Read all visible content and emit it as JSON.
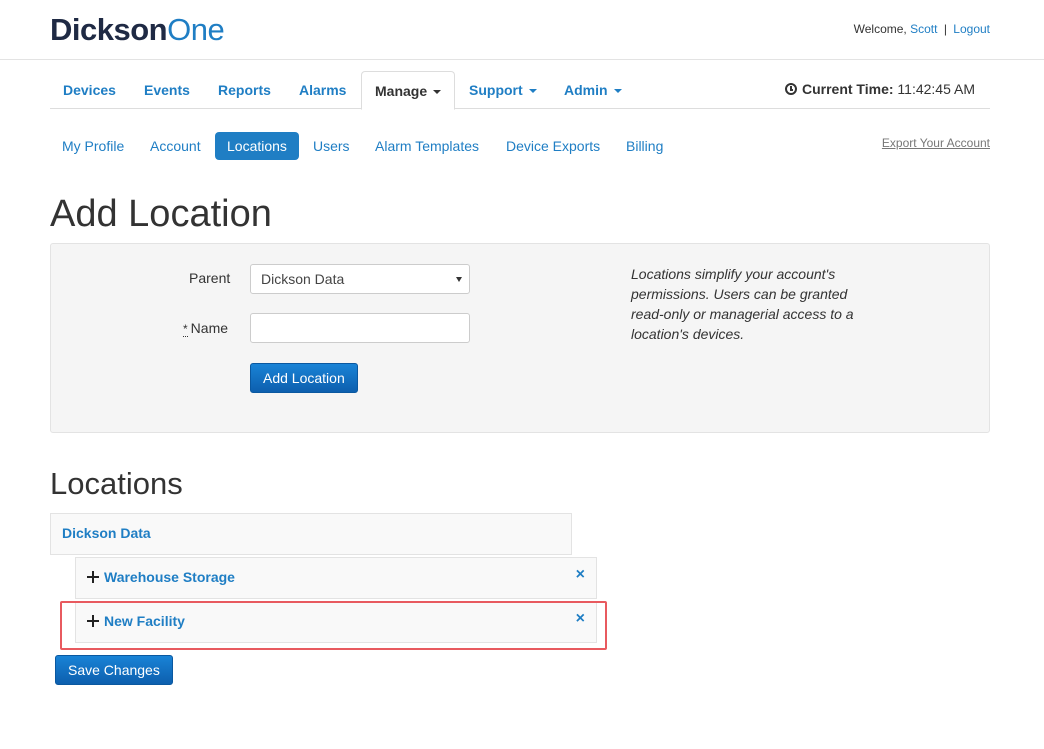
{
  "header": {
    "logo_part1": "Dickson",
    "logo_part2": "One",
    "welcome_text": "Welcome,",
    "user_name": "Scott",
    "separator": "|",
    "logout_label": "Logout"
  },
  "main_nav": {
    "tabs": [
      {
        "label": "Devices"
      },
      {
        "label": "Events"
      },
      {
        "label": "Reports"
      },
      {
        "label": "Alarms"
      },
      {
        "label": "Manage",
        "active": true,
        "dropdown": true
      },
      {
        "label": "Support",
        "dropdown": true
      },
      {
        "label": "Admin",
        "dropdown": true
      }
    ],
    "current_time_label": "Current Time:",
    "current_time_value": "11:42:45 AM"
  },
  "sub_nav": {
    "items": [
      {
        "label": "My Profile"
      },
      {
        "label": "Account"
      },
      {
        "label": "Locations",
        "active": true
      },
      {
        "label": "Users"
      },
      {
        "label": "Alarm Templates"
      },
      {
        "label": "Device Exports"
      },
      {
        "label": "Billing"
      }
    ],
    "export_label": "Export Your Account"
  },
  "page": {
    "title": "Add Location"
  },
  "form": {
    "parent_label": "Parent",
    "parent_value": "Dickson Data",
    "name_required_mark": "*",
    "name_label": "Name",
    "name_value": "",
    "submit_label": "Add Location",
    "help_text": "Locations simplify your account's permissions. Users can be granted read-only or managerial access to a location's devices."
  },
  "locations": {
    "title": "Locations",
    "root": {
      "name": "Dickson Data"
    },
    "children": [
      {
        "name": "Warehouse Storage",
        "remove_icon": "×"
      },
      {
        "name": "New Facility",
        "remove_icon": "×"
      }
    ],
    "save_label": "Save Changes"
  },
  "colors": {
    "link": "#1f7ec4",
    "brand_dark": "#1f2a44",
    "highlight": "#e85a5f"
  }
}
